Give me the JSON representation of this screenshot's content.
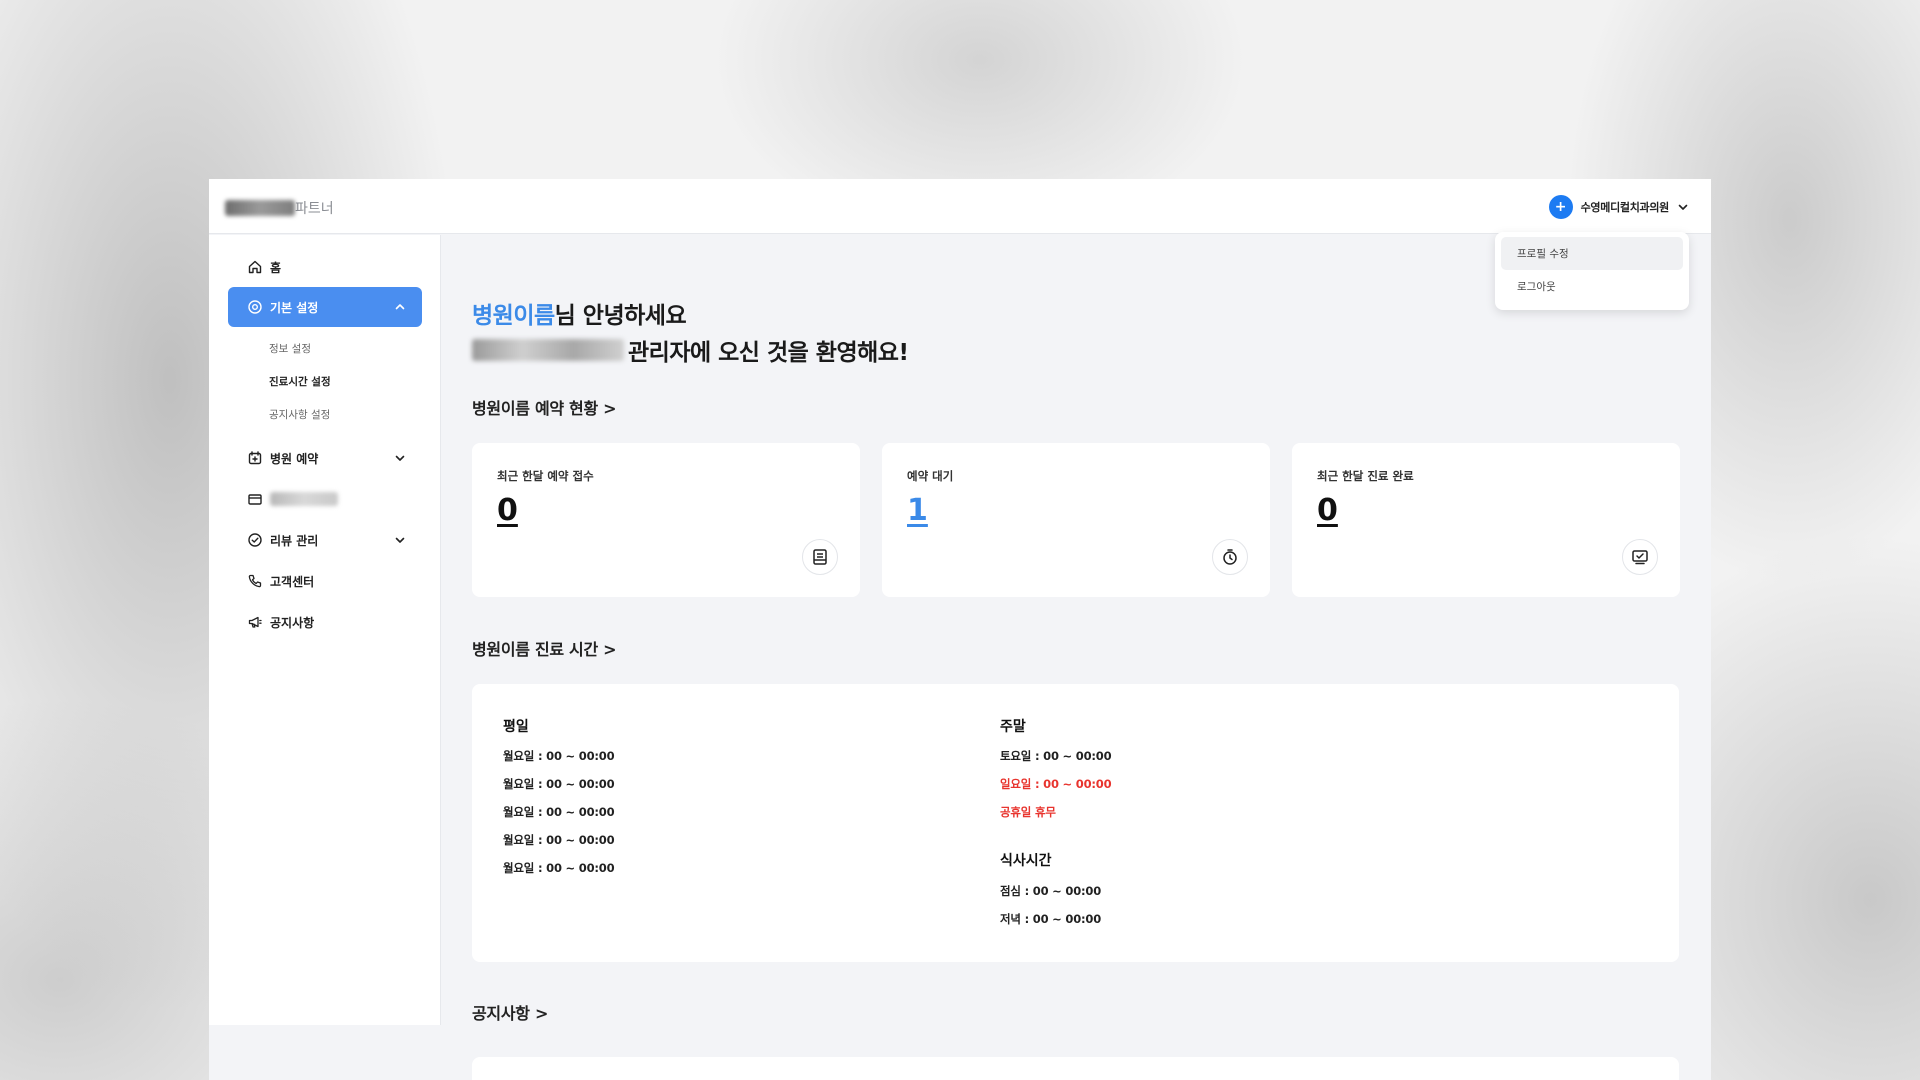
{
  "topbar": {
    "logo_text": "파트너",
    "user_name": "수영메디컬치과의원",
    "avatar_icon": "plus"
  },
  "dropdown": {
    "items": [
      {
        "label": "프로필 수정"
      },
      {
        "label": "로그아웃"
      }
    ]
  },
  "sidebar": {
    "items": [
      {
        "label": "홈",
        "icon": "home-icon"
      },
      {
        "label": "기본 설정",
        "icon": "settings-icon",
        "expanded": true
      },
      {
        "label": "병원 예약",
        "icon": "calendar-icon"
      },
      {
        "label": "",
        "icon": "card-icon"
      },
      {
        "label": "리뷰 관리",
        "icon": "review-icon"
      },
      {
        "label": "고객센터",
        "icon": "phone-icon"
      },
      {
        "label": "공지사항",
        "icon": "megaphone-icon"
      }
    ],
    "sub_items": [
      {
        "label": "정보 설정"
      },
      {
        "label": "진료시간 설정"
      },
      {
        "label": "공지사항 설정"
      }
    ]
  },
  "greeting": {
    "hospital": "병원이름",
    "line1_suffix": "님 안녕하세요",
    "line2_suffix": "관리자에 오신 것을 환영해요!"
  },
  "sections": {
    "reservations": "병원이름 예약 현황 >",
    "hours": "병원이름 진료 시간 >",
    "notices": "공지사항 >"
  },
  "stats": [
    {
      "label": "최근 한달 예약 접수",
      "value": "0",
      "icon": "receipt-icon"
    },
    {
      "label": "예약 대기",
      "value": "1",
      "icon": "timer-icon"
    },
    {
      "label": "최근 한달 진료 완료",
      "value": "0",
      "icon": "monitor-check-icon"
    }
  ],
  "hours": {
    "weekday_title": "평일",
    "weekday": [
      "월요일 : 00 ~ 00:00",
      "월요일 : 00 ~ 00:00",
      "월요일 : 00 ~ 00:00",
      "월요일 : 00 ~ 00:00",
      "월요일 : 00 ~ 00:00"
    ],
    "weekend_title": "주말",
    "weekend": [
      "토요일 : 00 ~ 00:00",
      "일요일 : 00 ~ 00:00",
      "공휴일 휴무"
    ],
    "meal_title": "식사시간",
    "meal": [
      "점심 : 00 ~ 00:00",
      "저녁 : 00 ~ 00:00"
    ]
  },
  "colors": {
    "accent": "#3b8ae8",
    "active_nav": "#4a8ef0",
    "holiday_red": "#e8342e"
  }
}
